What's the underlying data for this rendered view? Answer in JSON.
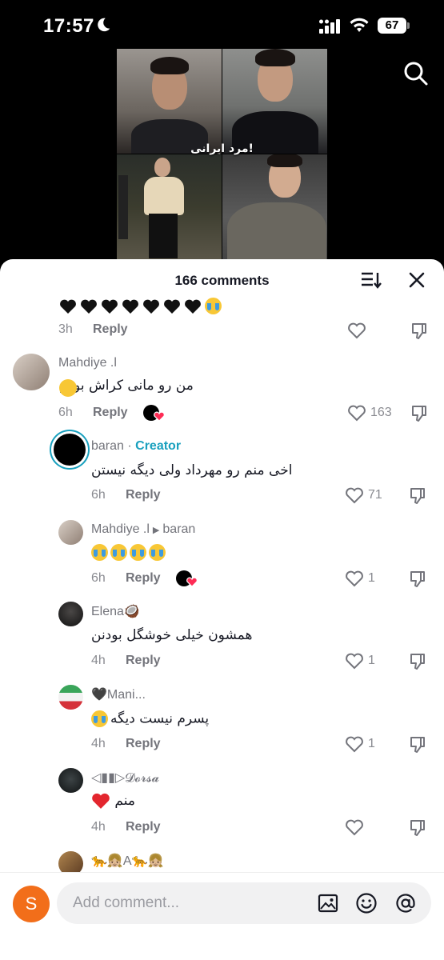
{
  "status_bar": {
    "time": "17:57",
    "battery": "67"
  },
  "video": {
    "caption": "مرد ایرانی!"
  },
  "sheet": {
    "title": "166 comments"
  },
  "comments": [
    {
      "id": "c0",
      "text_suffix_emoji": "crying-face",
      "hearts": 7,
      "time": "3h",
      "reply_label": "Reply",
      "likes": ""
    },
    {
      "id": "c1",
      "username": "Mahdiye .l",
      "text": "من رو مانی کراش بودم",
      "time": "6h",
      "reply_label": "Reply",
      "likes": "163",
      "creator_liked": true
    },
    {
      "id": "c2",
      "username": "baran",
      "creator_tag": "Creator",
      "text": "اخی منم رو مهرداد ولی دیگه نیستن",
      "time": "6h",
      "reply_label": "Reply",
      "likes": "71"
    },
    {
      "id": "c3",
      "username": "Mahdiye .l",
      "reply_to": "baran",
      "text_emojis": 4,
      "time": "6h",
      "reply_label": "Reply",
      "likes": "1",
      "creator_liked": true
    },
    {
      "id": "c4",
      "username": "Elena🥥",
      "text": "همشون خیلی خوشگل بودنن",
      "time": "4h",
      "reply_label": "Reply",
      "likes": "1"
    },
    {
      "id": "c5",
      "username": "🖤Mani...",
      "text": "پسرم نیست دیگه",
      "time": "4h",
      "reply_label": "Reply",
      "likes": "1"
    },
    {
      "id": "c6",
      "username": "◁▮▮▷𝓓𝓸𝓻𝓼𝓪",
      "text": "منم",
      "time": "4h",
      "reply_label": "Reply",
      "likes": ""
    },
    {
      "id": "c7",
      "username": "🐆👧🏼A🐆👧🏼"
    }
  ],
  "composer": {
    "avatar_letter": "S",
    "placeholder": "Add comment..."
  },
  "colors": {
    "creator": "#19a0be",
    "composer_avatar": "#f26e1a",
    "creator_like_heart": "#fe2c55"
  }
}
